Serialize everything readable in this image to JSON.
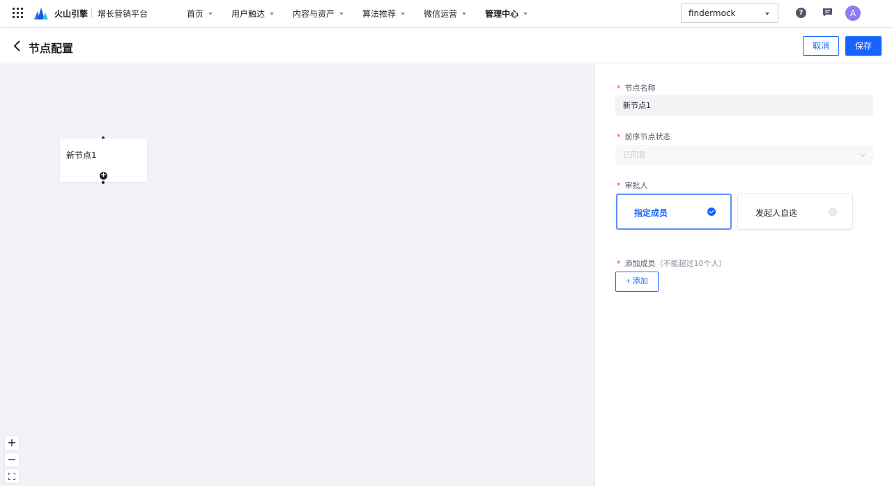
{
  "nav": {
    "brand": "火山引擎",
    "platform": "增长营销平台",
    "menu": [
      {
        "label": "首页"
      },
      {
        "label": "用户触达"
      },
      {
        "label": "内容与资产"
      },
      {
        "label": "算法推荐"
      },
      {
        "label": "微信运营"
      },
      {
        "label": "管理中心"
      }
    ],
    "active_menu": "管理中心",
    "tenant": "findermock",
    "avatar_initial": "A",
    "icons": {
      "apps": "grid-icon",
      "help": "help-icon",
      "messages": "message-icon"
    }
  },
  "header": {
    "title": "节点配置",
    "cancel_label": "取消",
    "save_label": "保存"
  },
  "canvas": {
    "node_label": "新节点1",
    "zoom_in": "+",
    "zoom_out": "−",
    "fit": "⛶"
  },
  "form": {
    "required_mark": "*",
    "node_name_label": "节点名称",
    "node_name_value": "新节点1",
    "prev_status_label": "前序节点状态",
    "prev_status_value": "已同意",
    "approver_label": "审批人",
    "approver_options": [
      {
        "label": "指定成员",
        "selected": true
      },
      {
        "label": "发起人自选",
        "selected": false
      }
    ],
    "add_member_label": "添加成员",
    "add_member_hint": "（不能超过10个人）",
    "add_button": "+ 添加"
  },
  "colors": {
    "primary": "#1664ff",
    "required": "#f53f3f",
    "canvas_bg": "#f2f3f8",
    "avatar": "#8c7cf0"
  }
}
